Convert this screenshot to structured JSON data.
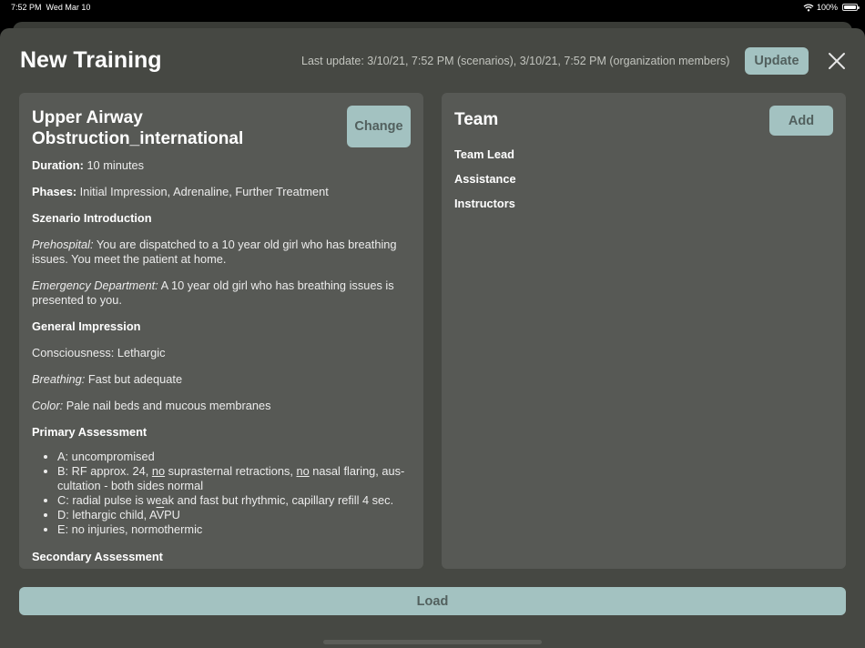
{
  "status_bar": {
    "time": "7:52 PM",
    "date": "Wed Mar 10",
    "battery": "100%",
    "wifi_icon": "wifi-icon"
  },
  "header": {
    "title": "New Training",
    "last_update": "Last update: 3/10/21, 7:52 PM (scenarios), 3/10/21, 7:52 PM (organization members)",
    "update_label": "Update",
    "close_icon": "close-icon"
  },
  "scenario": {
    "title": "Upper Airway Obstruction_international",
    "change_label": "Change",
    "duration_label": "Duration:",
    "duration_value": "10 minutes",
    "phases_label": "Phases:",
    "phases_value": "Initial Impression, Adrenaline, Further Treatment",
    "intro_heading": "Szenario Introduction",
    "prehospital_label": "Prehospital:",
    "prehospital_text": "You are dispatched to a 10 year old girl who has breathing issues. You meet the patient at home.",
    "ed_label": "Emergency Department:",
    "ed_text": "A 10 year old girl who has breathing issues is presented to you.",
    "general_heading": "General Impression",
    "consciousness": "Consciousness: Lethargic",
    "breathing_label": "Breathing:",
    "breathing_text": "Fast but adequate",
    "color_label": "Color:",
    "color_text": "Pale nail beds and mucous membranes",
    "primary_heading": "Primary Assessment",
    "assessment": {
      "a": "A: uncompromised",
      "b_1": "B: RF approx. 24,",
      "b_no1": "no",
      "b_2": "suprasternal retractions,",
      "b_no2": "no",
      "b_3": "nasal flaring, aus­cultation - both sides normal",
      "c": "C: radial pulse is weak and fast but rhythmic, capillary refill 4 sec.",
      "d_1": "D: lethargic child, A",
      "d_v": "V",
      "d_2": "PU",
      "e": "E: no injuries, normothermic"
    },
    "next_heading_partial": "Secondary Assessment"
  },
  "team": {
    "title": "Team",
    "add_label": "Add",
    "items": [
      "Team Lead",
      "Assistance",
      "Instructors"
    ]
  },
  "footer": {
    "load_label": "Load"
  },
  "colors": {
    "accent_button": "#a3c2c1",
    "sheet": "#464843",
    "card": "#575955"
  }
}
